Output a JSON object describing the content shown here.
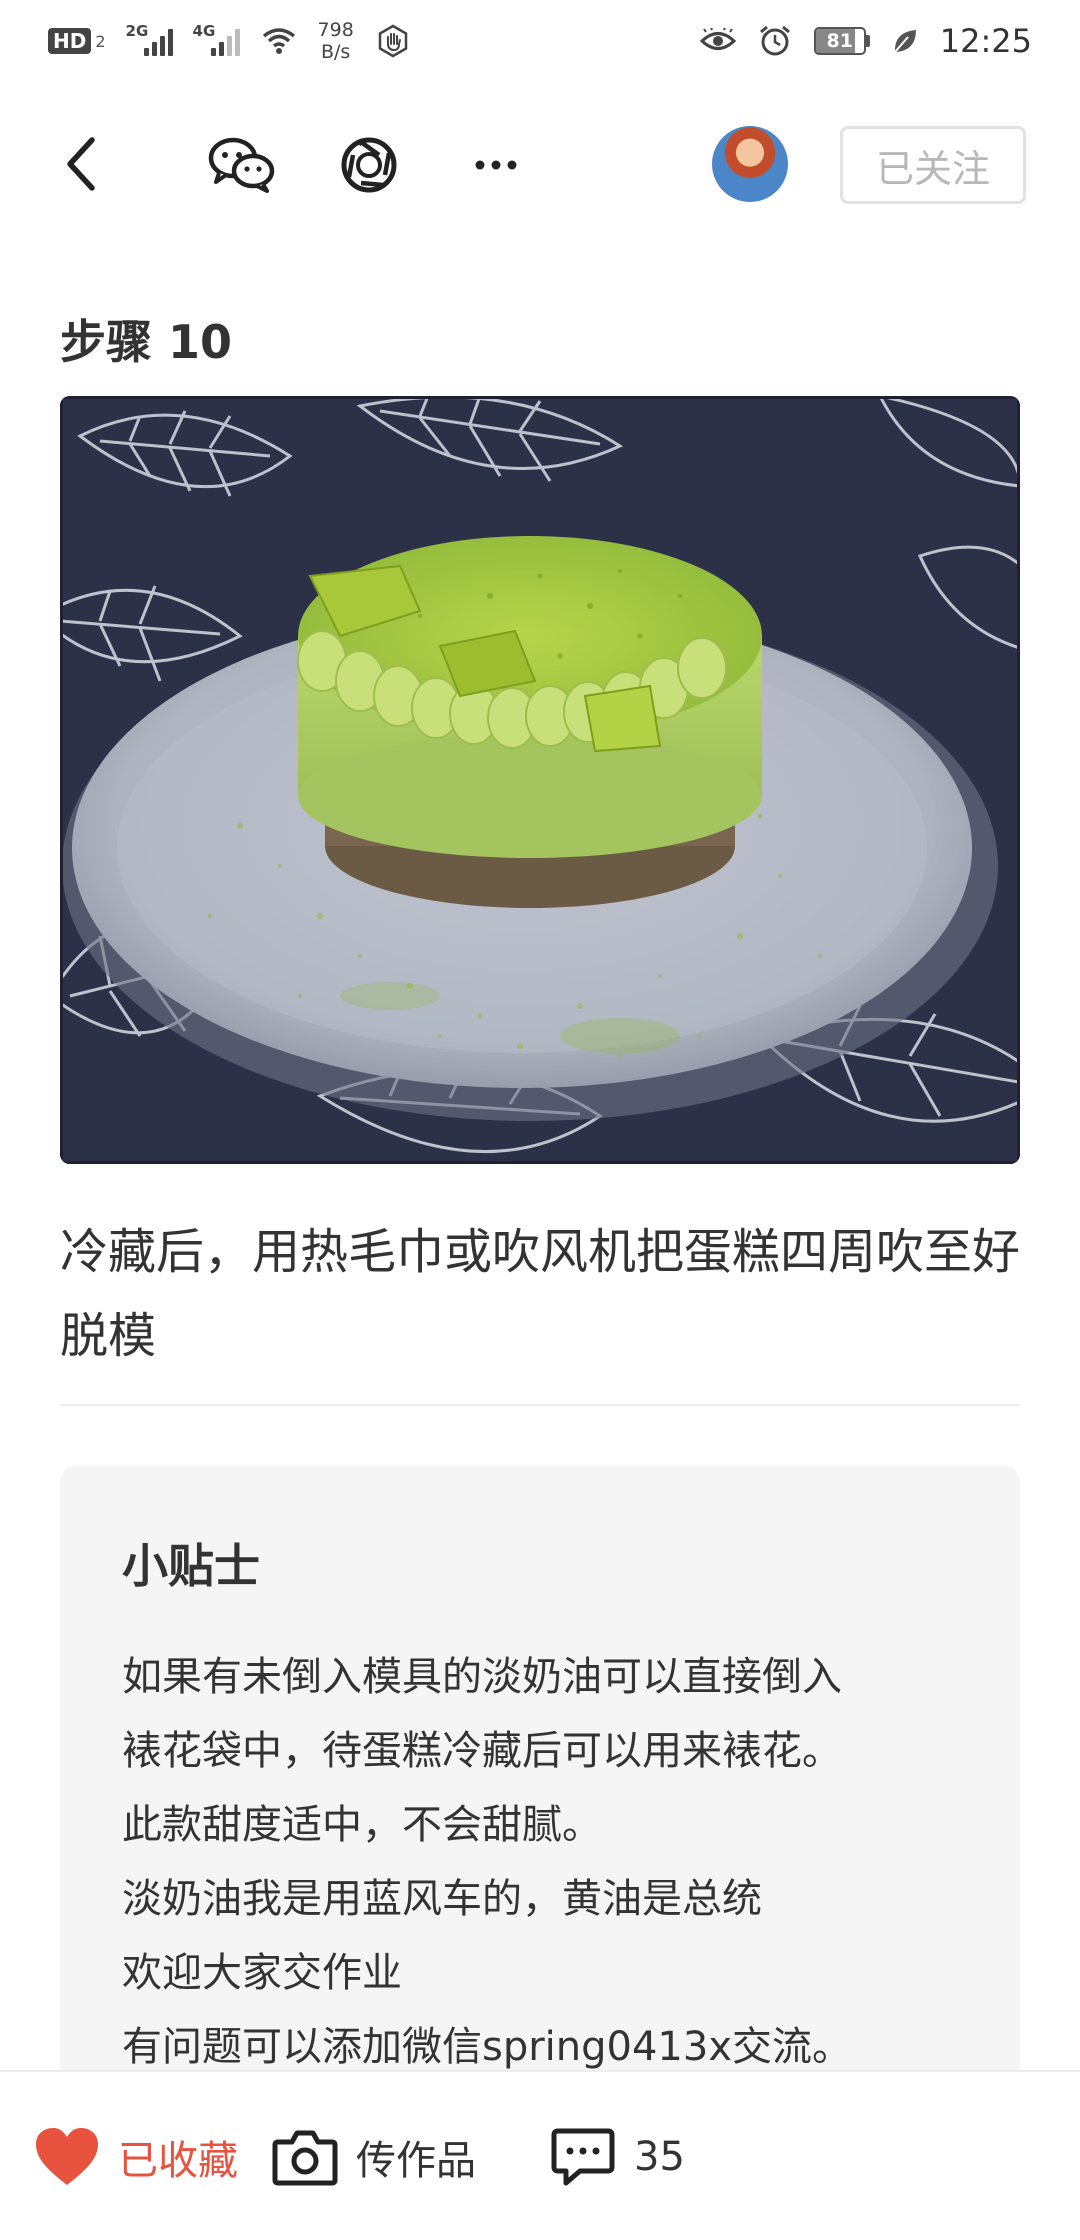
{
  "status_bar": {
    "hd_label": "HD",
    "hd_sub": "2",
    "net1": "2G",
    "net2": "4G",
    "speed_value": "798",
    "speed_unit": "B/s",
    "battery": "81",
    "time": "12:25"
  },
  "nav": {
    "follow_label": "已关注"
  },
  "step": {
    "title": "步骤 10",
    "description": "冷藏后，用热毛巾或吹风机把蛋糕四周吹至好脱模"
  },
  "tips": {
    "title": "小贴士",
    "lines": [
      "如果有未倒入模具的淡奶油可以直接倒入",
      "裱花袋中，待蛋糕冷藏后可以用来裱花。",
      "此款甜度适中，不会甜腻。",
      "淡奶油我是用蓝风车的，黄油是总统",
      "欢迎大家交作业",
      "有问题可以添加微信spring0413x交流。"
    ]
  },
  "bottom_bar": {
    "favorite_label": "已收藏",
    "upload_label": "传作品",
    "comment_count": "35"
  },
  "colors": {
    "accent_red": "#e8533f",
    "matcha_green": "#8fbf3a",
    "follow_border": "#e2e2e2"
  }
}
